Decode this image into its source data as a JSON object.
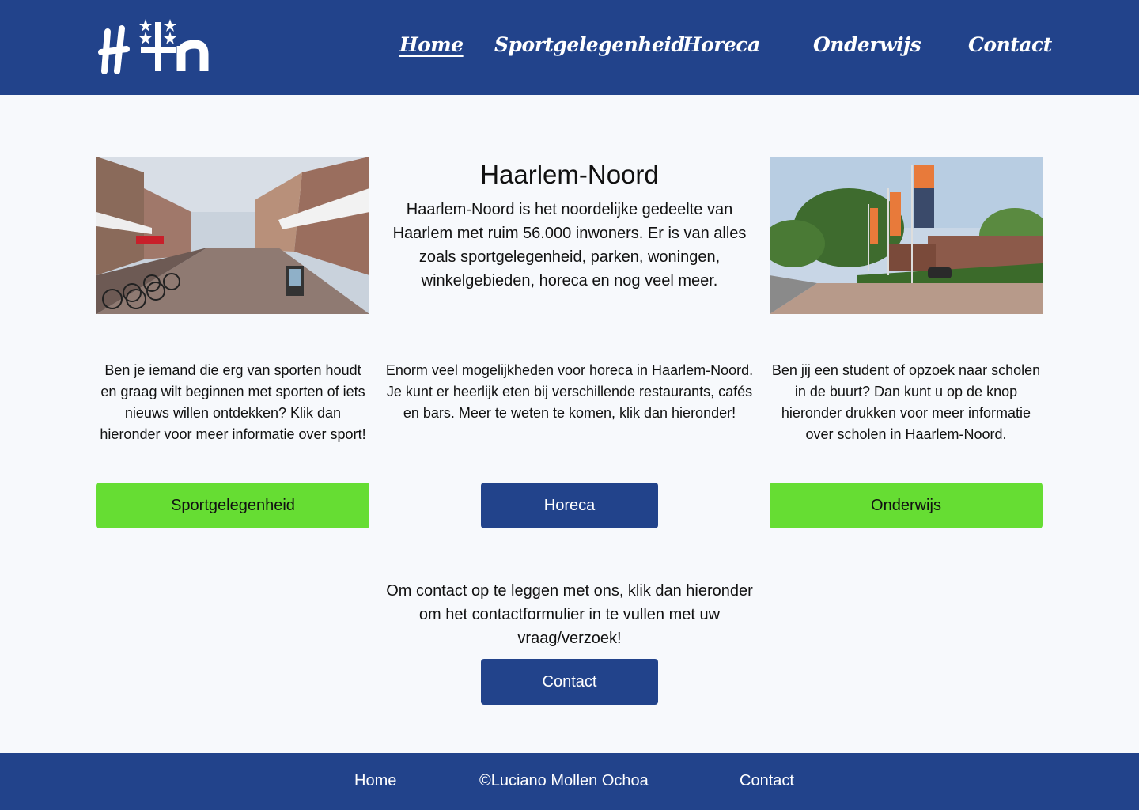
{
  "header": {
    "logo_alt": "H+n",
    "nav": [
      {
        "label": "Home",
        "active": true
      },
      {
        "label": "Sportgelegenheid",
        "active": false
      },
      {
        "label": "Horeca",
        "active": false
      },
      {
        "label": "Onderwijs",
        "active": false
      },
      {
        "label": "Contact",
        "active": false
      }
    ]
  },
  "intro": {
    "title": "Haarlem-Noord",
    "text": "Haarlem-Noord is het noordelijke gedeelte van Haarlem met ruim 56.000 inwoners. Er is van alles zoals sportgelegenheid, parken, woningen, winkelgebieden, horeca en nog veel meer."
  },
  "sections": {
    "sport": {
      "text": "Ben je iemand die erg van sporten houdt en graag wilt beginnen met sporten of iets nieuws willen ontdekken? Klik dan hieronder voor meer informatie over sport!",
      "button": "Sportgelegenheid"
    },
    "horeca": {
      "text": "Enorm veel mogelijkheden voor horeca in Haarlem-Noord. Je kunt er heerlijk eten bij verschillende restaurants, cafés en bars. Meer te weten te komen, klik dan hieronder!",
      "button": "Horeca"
    },
    "onderwijs": {
      "text": "Ben jij een student of opzoek naar scholen in de buurt? Dan kunt u op de knop hieronder drukken voor meer informatie over scholen in Haarlem-Noord.",
      "button": "Onderwijs"
    },
    "contact": {
      "text": "Om contact op te leggen met ons, klik dan hieronder om het contactformulier in te vullen met uw vraag/verzoek!",
      "button": "Contact"
    }
  },
  "footer": {
    "home": "Home",
    "copyright": "©Luciano Mollen Ochoa",
    "contact": "Contact"
  },
  "colors": {
    "primary": "#22438b",
    "accent_green": "#66dd33",
    "background": "#f7f9fc"
  }
}
